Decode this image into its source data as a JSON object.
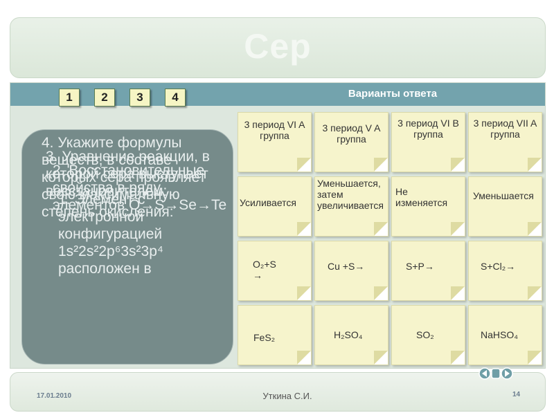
{
  "title": "Сер",
  "header": {
    "title": "Варианты ответа"
  },
  "question_buttons": [
    "1",
    "2",
    "3",
    "4"
  ],
  "question_text": {
    "layer1": "4. Укажите формулы веществ, в составе которых сера проявляет свою максимальную степень окисления:",
    "layer2": "3. Уравнение реакции, в которой сера выступает восстановителем:",
    "layer3": "2. Восстановительные свойства в ряду элементов O→S→Se→Te",
    "layer4": "1. Элемент с электронной конфигурацией 1s²2s²2p⁶3s²3p⁴ расположен в"
  },
  "answers": {
    "row1": [
      "3 период VI A группа",
      "3 период V A группа",
      "3 период VI B группа",
      "3 период VII A группа"
    ],
    "row2": [
      "Усиливается",
      "Уменьшается, затем увеличивается",
      "Не изменяется",
      "Уменьшается"
    ],
    "row3": [
      "O₂+S →",
      "Cu +S→",
      "S+P→",
      "S+Cl₂→"
    ],
    "row4": [
      "FeS₂",
      "H₂SO₄",
      "SO₂",
      "NaHSO₄"
    ]
  },
  "footer": {
    "date": "17.01.2010",
    "author": "Уткина С.И.",
    "page": "14"
  }
}
